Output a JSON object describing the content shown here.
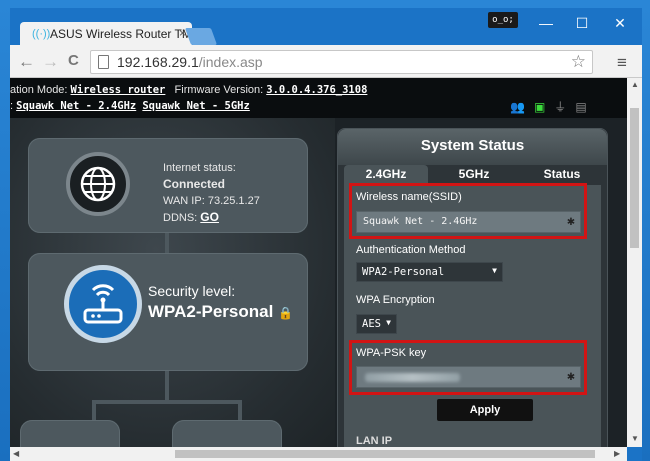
{
  "browser": {
    "tab_title": "ASUS Wireless Router TM",
    "tab_close": "×",
    "user_badge": "o_o;",
    "win_minimize": "—",
    "win_maximize": "☐",
    "win_close": "✕",
    "url_host": "192.168.29.1",
    "url_path": "/index.asp",
    "back": "←",
    "forward": "→",
    "reload": "C",
    "star": "☆",
    "menu": "≡"
  },
  "header": {
    "op_mode_label": "ation Mode:",
    "op_mode_value": "Wireless router",
    "firmware_label": "Firmware Version:",
    "firmware_value": "3.0.0.4.376_3108",
    "ssid_prefix": ":",
    "ssid_24": "Squawk Net - 2.4GHz",
    "ssid_5": "Squawk Net - 5GHz"
  },
  "internet": {
    "status_label": "Internet status:",
    "status_value": "Connected",
    "wan_label": "WAN IP:",
    "wan_value": "73.25.1.27",
    "ddns_label": "DDNS:",
    "ddns_value": "GO"
  },
  "security": {
    "label": "Security level:",
    "value": "WPA2-Personal"
  },
  "status_panel": {
    "title": "System Status",
    "tabs": [
      "2.4GHz",
      "5GHz",
      "Status"
    ],
    "ssid_label": "Wireless name(SSID)",
    "ssid_value": "Squawk Net - 2.4GHz",
    "auth_label": "Authentication Method",
    "auth_value": "WPA2-Personal",
    "enc_label": "WPA Encryption",
    "enc_value": "AES",
    "psk_label": "WPA-PSK key",
    "apply_label": "Apply",
    "lan_label": "LAN IP"
  },
  "colors": {
    "highlight": "#d21414",
    "accent_blue": "#1b6db8",
    "status_active": "#3cdc3c"
  }
}
